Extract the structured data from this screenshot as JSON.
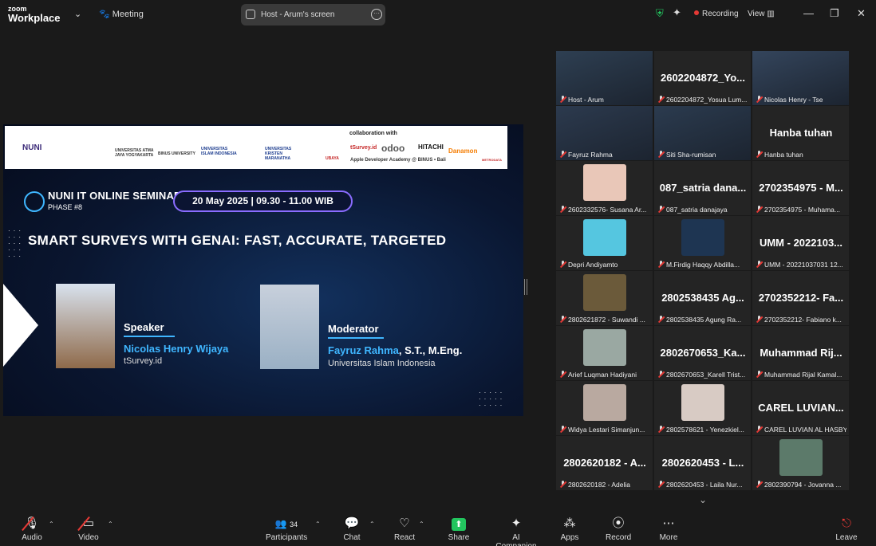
{
  "app": {
    "logo_line1": "zoom",
    "logo_line2": "Workplace",
    "meeting_label": "Meeting"
  },
  "screen_tab": {
    "label": "Host - Arum's screen"
  },
  "status": {
    "recording": "Recording",
    "view": "View"
  },
  "slide": {
    "collab": "collaboration with",
    "sponsors": [
      "NUNI",
      "UNIVERSITAS ATMA JAYA YOGYAKARTA",
      "BINUS UNIVERSITY",
      "UNIVERSITAS ISLAM INDONESIA",
      "UNIVERSITAS KRISTEN MARANATHA",
      "UBAYA",
      "tSurvey.id",
      "odoo",
      "HITACHI",
      "Danamon",
      "METRODATA",
      "Apple Developer Academy @ BINUS • Bali"
    ],
    "seminar_title": "NUNI IT ONLINE SEMINAR",
    "phase": "PHASE #8",
    "date": "20 May 2025 | 09.30 - 11.00 WIB",
    "title": "SMART SURVEYS WITH GENAI: FAST, ACCURATE, TARGETED",
    "speaker_role": "Speaker",
    "speaker_name": "Nicolas Henry Wijaya",
    "speaker_org": "tSurvey.id",
    "moderator_role": "Moderator",
    "moderator_name": "Fayruz Rahma",
    "moderator_suffix": ", S.T., M.Eng.",
    "moderator_org": "Universitas Islam Indonesia"
  },
  "participants": [
    {
      "big": "",
      "cap": "Host - Arum",
      "video": "#2e3f52",
      "active": true
    },
    {
      "big": "2602204872_Yo...",
      "cap": "2602204872_Yosua Lum..."
    },
    {
      "big": "",
      "cap": "Nicolas Henry - Tse",
      "video": "#34455c"
    },
    {
      "big": "",
      "cap": "Fayruz Rahma",
      "video": "#2c3a4e"
    },
    {
      "big": "",
      "cap": "Siti Sha-rumisan",
      "video": "#2b3b4f"
    },
    {
      "big": "Hanba tuhan",
      "cap": "Hanba tuhan"
    },
    {
      "big": "",
      "cap": "2602332576- Susana Ar...",
      "avatar": "#e9c7b8"
    },
    {
      "big": "087_satria dana...",
      "cap": "087_satria danajaya"
    },
    {
      "big": "2702354975 - M...",
      "cap": "2702354975 - Muhama..."
    },
    {
      "big": "",
      "cap": "Depri Andiyamto",
      "avatar": "#55c6e0"
    },
    {
      "big": "",
      "cap": "M.Firdig Haqqy Abdilla...",
      "avatar": "#1e3552"
    },
    {
      "big": "UMM - 2022103...",
      "cap": "UMM - 20221037031 12..."
    },
    {
      "big": "",
      "cap": "2802621872 - Suwandi ...",
      "avatar": "#6b5a3a"
    },
    {
      "big": "2802538435  Ag...",
      "cap": "2802538435 Agung Ra..."
    },
    {
      "big": "2702352212-  Fa...",
      "cap": "2702352212- Fabiano k..."
    },
    {
      "big": "",
      "cap": "Arief Luqman Hadiyani",
      "avatar": "#9aa8a2"
    },
    {
      "big": "2802670653_Ka...",
      "cap": "2802670653_Karell Trist..."
    },
    {
      "big": "Muhammad  Rij...",
      "cap": "Muhammad Rijal Kamal..."
    },
    {
      "big": "",
      "cap": "Widya Lestari Simanjun...",
      "avatar": "#b9a9a0"
    },
    {
      "big": "",
      "cap": "2802578621 - Yenezkiel...",
      "avatar": "#d8cbc4"
    },
    {
      "big": "CAREL LUVIAN...",
      "cap": "CAREL LUVIAN AL HASBY"
    },
    {
      "big": "2802620182 - A...",
      "cap": "2802620182 - Adelia"
    },
    {
      "big": "2802620453 - L...",
      "cap": "2802620453 - Laila Nur..."
    },
    {
      "big": "",
      "cap": "2802390794 - Jovanna ...",
      "avatar": "#5c7a6a"
    }
  ],
  "toolbar": {
    "audio": "Audio",
    "video": "Video",
    "participants": "Participants",
    "participants_count": "34",
    "chat": "Chat",
    "react": "React",
    "share": "Share",
    "ai": "AI Companion",
    "apps": "Apps",
    "record": "Record",
    "more": "More",
    "leave": "Leave"
  },
  "colors": {
    "accent_green": "#22c55e",
    "active_border": "#3ddc84",
    "mute_red": "#e53935",
    "slide_blue": "#3fb6ff"
  }
}
